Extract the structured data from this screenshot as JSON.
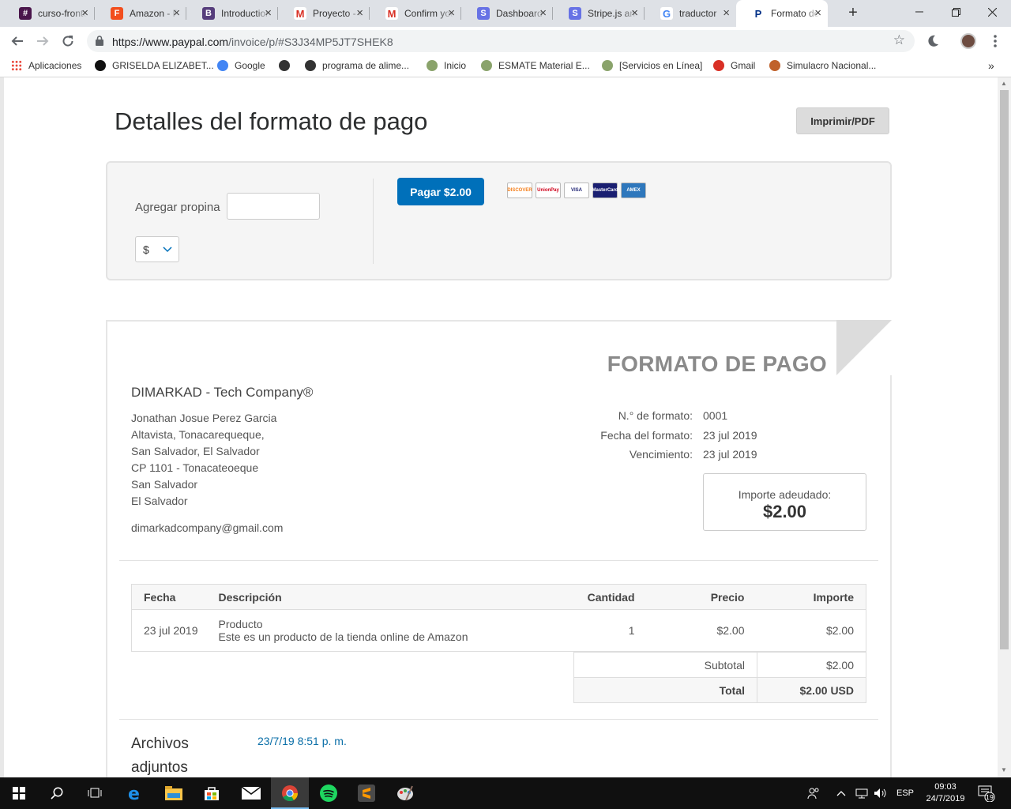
{
  "browser": {
    "tabs": [
      {
        "title": "curso-frontend",
        "favicon_color": "#4a154b",
        "favicon_glyph": "#"
      },
      {
        "title": "Amazon - Figma",
        "favicon_color": "#f24e1e",
        "favicon_glyph": "F"
      },
      {
        "title": "Introduction · Bootstrap",
        "favicon_color": "#563d7c",
        "favicon_glyph": "B"
      },
      {
        "title": "Proyecto - Gmail",
        "favicon_color": "#ffffff",
        "favicon_glyph": "M"
      },
      {
        "title": "Confirm your account",
        "favicon_color": "#ffffff",
        "favicon_glyph": "M"
      },
      {
        "title": "Dashboard",
        "favicon_color": "#6772e5",
        "favicon_glyph": "S"
      },
      {
        "title": "Stripe.js and Elements",
        "favicon_color": "#6772e5",
        "favicon_glyph": "S"
      },
      {
        "title": "traductor",
        "favicon_color": "#ffffff",
        "favicon_glyph": "G"
      },
      {
        "title": "Formato de pago",
        "favicon_color": "#ffffff",
        "favicon_glyph": "P"
      }
    ],
    "active_tab_index": 8,
    "url_host": "https://www.paypal.com",
    "url_path": "/invoice/p/#S3J34MP5JT7SHEK8",
    "bookmarks": [
      {
        "label": "Aplicaciones",
        "icon": "apps-grid-icon",
        "color": "#e94235"
      },
      {
        "label": "GRISELDA ELIZABET...",
        "icon": "skype-icon",
        "color": "#111111"
      },
      {
        "label": "Google",
        "icon": "google-icon",
        "color": "#4285f4"
      },
      {
        "label": "",
        "icon": "globe-icon",
        "color": "#333333"
      },
      {
        "label": "programa de alime...",
        "icon": "globe-icon",
        "color": "#333333"
      },
      {
        "label": "Inicio",
        "icon": "seal-icon",
        "color": "#8aa36b"
      },
      {
        "label": "ESMATE Material E...",
        "icon": "seal-icon",
        "color": "#8aa36b"
      },
      {
        "label": "[Servicios en Línea]",
        "icon": "seal-icon",
        "color": "#8aa36b"
      },
      {
        "label": "Gmail",
        "icon": "gmail-icon",
        "color": "#d93025"
      },
      {
        "label": "Simulacro Nacional...",
        "icon": "globe-icon",
        "color": "#c0622b"
      }
    ]
  },
  "page": {
    "title": "Detalles del formato de pago",
    "print_button": "Imprimir/PDF",
    "tip_label": "Agregar propina",
    "tip_value": "",
    "currency_selected": "$",
    "pay_button": "Pagar $2.00",
    "cards": [
      {
        "name": "DISCOVER",
        "color": "#f58220"
      },
      {
        "name": "UnionPay",
        "color": "#d0021b"
      },
      {
        "name": "VISA",
        "color": "#1a1f71"
      },
      {
        "name": "MasterCard",
        "color": "#eb001b"
      },
      {
        "name": "AMEX",
        "color": "#2e77bc"
      }
    ]
  },
  "invoice": {
    "heading": "FORMATO DE PAGO",
    "business_name": "DIMARKAD - Tech Company®",
    "address_lines": [
      "Jonathan Josue Perez Garcia",
      "Altavista, Tonacarequeque,",
      "San Salvador, El Salvador",
      "CP 1101 - Tonacateoeque",
      "San Salvador",
      "El Salvador"
    ],
    "email": "dimarkadcompany@gmail.com",
    "meta_labels": [
      "N.° de formato:",
      "Fecha del formato:",
      "Vencimiento:"
    ],
    "meta_values": [
      "0001",
      "23 jul 2019",
      "23 jul 2019"
    ],
    "amount_due_label": "Importe adeudado:",
    "amount_due": "$2.00",
    "columns": [
      "Fecha",
      "Descripción",
      "Cantidad",
      "Precio",
      "Importe"
    ],
    "items": [
      {
        "date": "23 jul 2019",
        "name": "Producto",
        "description": "Este es un producto de la tienda online de Amazon",
        "quantity": "1",
        "price": "$2.00",
        "amount": "$2.00"
      }
    ],
    "subtotal_label": "Subtotal",
    "subtotal": "$2.00",
    "total_label": "Total",
    "total": "$2.00 USD",
    "attachments_label": "Archivos adjuntos",
    "attachment_date": "23/7/19 8:51 p. m."
  },
  "taskbar": {
    "apps": [
      "start-icon",
      "search-icon",
      "task-view-icon",
      "edge-icon",
      "file-explorer-icon",
      "store-icon",
      "mail-icon",
      "chrome-icon",
      "spotify-icon",
      "sublime-text-icon",
      "paint-icon"
    ],
    "active_app": "chrome-icon",
    "language": "ESP",
    "time": "09:03",
    "date": "24/7/2019",
    "notification_count": "19"
  }
}
